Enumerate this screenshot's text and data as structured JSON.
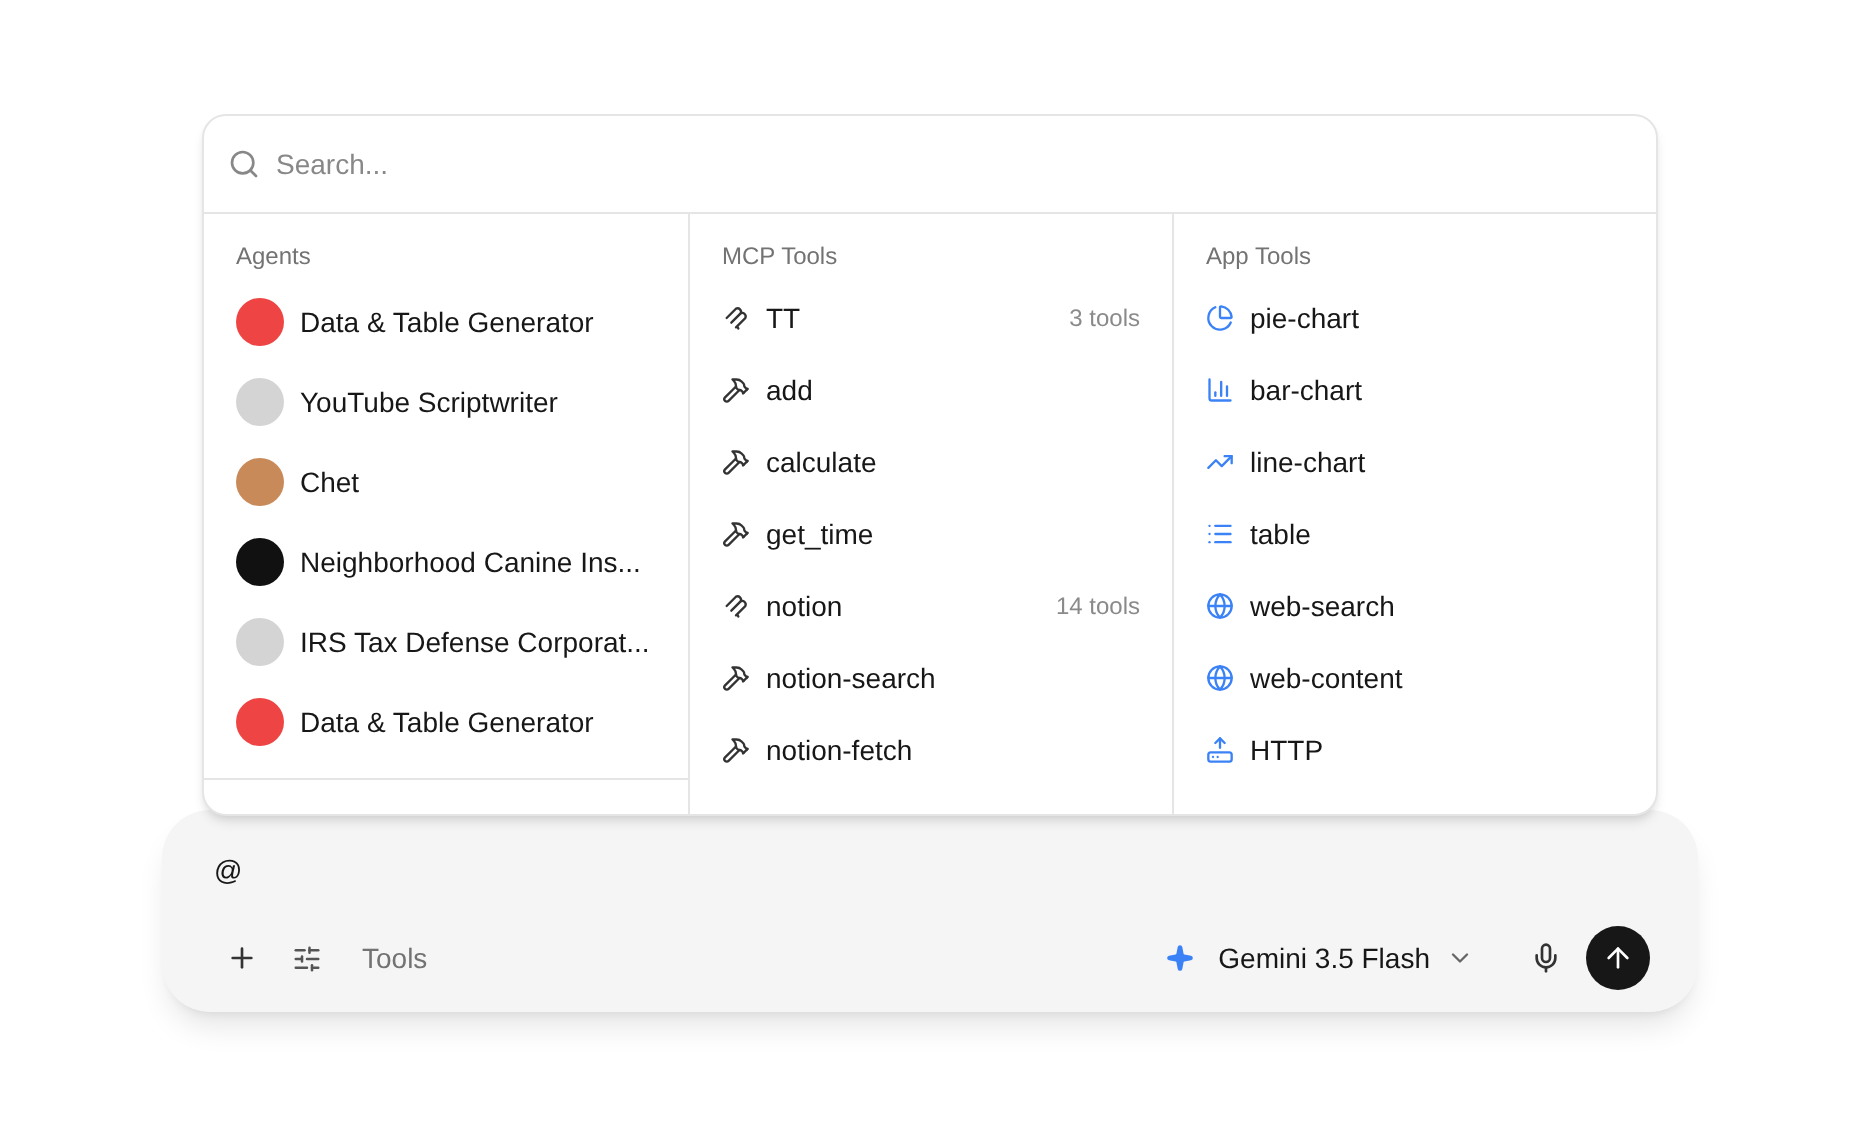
{
  "search": {
    "placeholder": "Search..."
  },
  "columns": [
    {
      "title": "Agents",
      "kind": "agents",
      "items": [
        {
          "label": "Data & Table Generator",
          "color": "#ef4444"
        },
        {
          "label": "YouTube Scriptwriter",
          "color": "#d4d4d4"
        },
        {
          "label": "Chet",
          "color": "#c98a5a"
        },
        {
          "label": "Neighborhood Canine Ins...",
          "color": "#111111"
        },
        {
          "label": "IRS Tax Defense Corporat...",
          "color": "#d4d4d4"
        },
        {
          "label": "Data & Table Generator",
          "color": "#ef4444"
        }
      ]
    },
    {
      "title": "MCP Tools",
      "kind": "mcp",
      "items": [
        {
          "label": "TT",
          "kind": "server",
          "count": "3 tools"
        },
        {
          "label": "add",
          "kind": "tool"
        },
        {
          "label": "calculate",
          "kind": "tool"
        },
        {
          "label": "get_time",
          "kind": "tool"
        },
        {
          "label": "notion",
          "kind": "server",
          "count": "14 tools"
        },
        {
          "label": "notion-search",
          "kind": "tool"
        },
        {
          "label": "notion-fetch",
          "kind": "tool"
        }
      ]
    },
    {
      "title": "App Tools",
      "kind": "app",
      "items": [
        {
          "label": "pie-chart",
          "kind": "pie"
        },
        {
          "label": "bar-chart",
          "kind": "bar"
        },
        {
          "label": "line-chart",
          "kind": "line"
        },
        {
          "label": "table",
          "kind": "table"
        },
        {
          "label": "web-search",
          "kind": "globe"
        },
        {
          "label": "web-content",
          "kind": "globe"
        },
        {
          "label": "HTTP",
          "kind": "upload"
        }
      ]
    }
  ],
  "composer": {
    "value": "@",
    "tools_label": "Tools",
    "model": "Gemini 3.5 Flash"
  }
}
